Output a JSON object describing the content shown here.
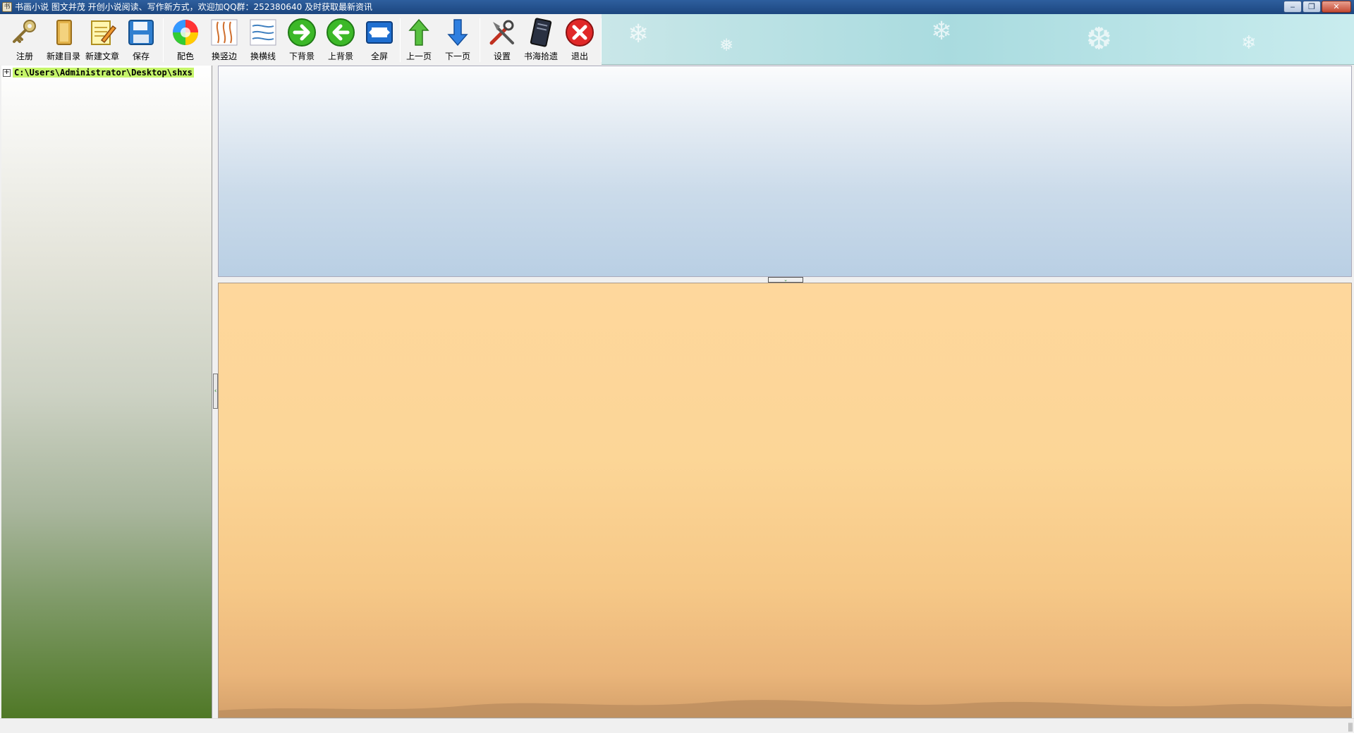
{
  "window": {
    "title": "书画小说 图文并茂 开创小说阅读、写作新方式，欢迎加QQ群：252380640  及时获取最新资讯",
    "app_icon_glyph": "书",
    "controls": {
      "minimize": "‒",
      "maximize": "❐",
      "close": "✕"
    }
  },
  "toolbar": {
    "items": [
      {
        "label": "注册",
        "icon": "key-icon"
      },
      {
        "label": "新建目录",
        "icon": "folder-icon"
      },
      {
        "label": "新建文章",
        "icon": "notepad-pencil-icon"
      },
      {
        "label": "保存",
        "icon": "floppy-save-icon"
      },
      {
        "label": "配色",
        "icon": "color-wheel-icon"
      },
      {
        "label": "换竖边",
        "icon": "vertical-lines-icon"
      },
      {
        "label": "换横线",
        "icon": "horizontal-lines-icon"
      },
      {
        "label": "下背景",
        "icon": "arrow-right-circle-icon"
      },
      {
        "label": "上背景",
        "icon": "arrow-left-circle-icon"
      },
      {
        "label": "全屏",
        "icon": "fullscreen-icon"
      },
      {
        "label": "上一页",
        "icon": "arrow-up-icon"
      },
      {
        "label": "下一页",
        "icon": "arrow-down-icon"
      },
      {
        "label": "设置",
        "icon": "tools-icon"
      },
      {
        "label": "书海拾遗",
        "icon": "book-icon"
      },
      {
        "label": "退出",
        "icon": "exit-x-icon"
      }
    ]
  },
  "tree": {
    "root_label": "C:\\Users\\Administrator\\Desktop\\shxs",
    "expander": "+"
  },
  "splitters": {
    "vertical_glyph": "‹",
    "horizontal_glyph": "⌄"
  },
  "colors": {
    "title_bar": "#1c467f",
    "tree_highlight": "#c6f56b",
    "top_panel": "#b9cfe4",
    "bottom_panel": "#fcd697",
    "left_panel_bottom": "#4f7826"
  }
}
